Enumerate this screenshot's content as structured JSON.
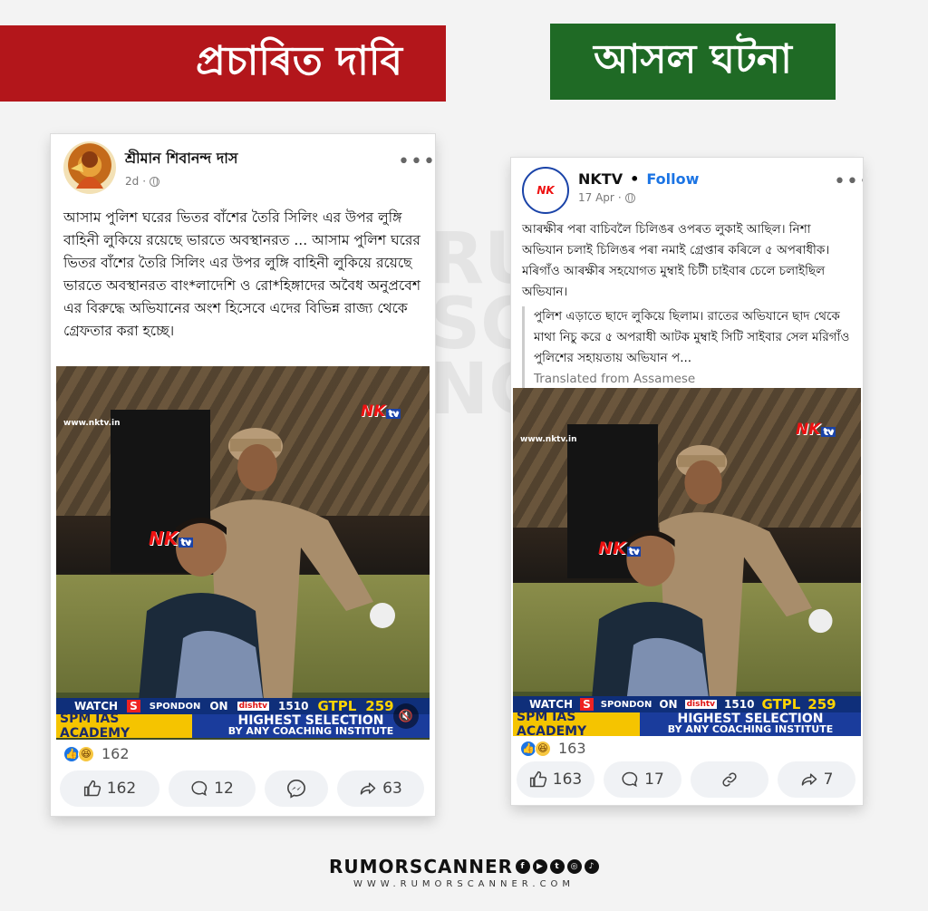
{
  "banners": {
    "claim_label": "প্ৰচাৰিত দাবি",
    "fact_label": "আসল ঘটনা"
  },
  "left_post": {
    "author": "শ্রীমান শিবানন্দ দাস",
    "time": "2d",
    "more_label": "•••",
    "text": "আসাম পুলিশ ঘরের ভিতর বাঁশের তৈরি সিলিং এর উপর লুঙ্গি বাহিনী লুকিয়ে রয়েছে ভারতে অবস্থানরত ... আসাম পুলিশ ঘরের ভিতর বাঁশের তৈরি সিলিং এর উপর লুঙ্গি বাহিনী লুকিয়ে রয়েছে ভারতে অবস্থানরত বাং*লাদেশি ও রো*হিঙ্গাদের অবৈধ অনুপ্রবেশ এর বিরুদ্ধে অভিযানের অংশ হিসেবে এদের বিভিন্ন রাজ্য থেকে গ্রেফতার করা হচ্ছে।",
    "reactions_count": "162",
    "actions": {
      "like": "162",
      "comment": "12",
      "share": "63"
    }
  },
  "right_post": {
    "author": "NKTV",
    "dot": "•",
    "follow_label": "Follow",
    "time": "17 Apr",
    "more_label": "•••",
    "avatar_text": "NK",
    "text": "আৰক্ষীৰ পৰা বাচিবলৈ চিলিঙৰ ওপৰত লুকাই আছিল। নিশা অভিযান চলাই চিলিঙৰ পৰা নমাই গ্ৰেপ্তাৰ কৰিলে ৫ অপৰাধীক। মৰিগাঁও আৰক্ষীৰ সহযোগত মুম্বাই চিটী চাইবাৰ চেলে চলাইছিল অভিযান।",
    "translation": "পুলিশ এড়াতে ছাদে লুকিয়ে ছিলাম। রাতের অভিযানে ছাদ থেকে মাথা নিচু করে ৫ অপরাধী আটক মুম্বাই সিটি সাইবার সেল মরিগাঁও পুলিশের সহায়তায় অভিযান প...",
    "translated_from": "Translated from Assamese",
    "reactions_count": "163",
    "actions": {
      "like": "163",
      "comment": "17",
      "share": "7"
    }
  },
  "video": {
    "site": "www.nktv.in",
    "logo": "NK",
    "logo_tv": "tv",
    "ticker_watch": "WATCH",
    "ticker_s": "S",
    "ticker_spondon": "SPONDON",
    "ticker_on": "ON",
    "ticker_dish": "dishtv",
    "ticker_num1": "1510",
    "ticker_gtpl": "GTPL",
    "ticker_num2": "259",
    "academy": "SPM IAS ACADEMY",
    "highest": "HIGHEST SELECTION",
    "coaching": "BY ANY COACHING INSTITUTE"
  },
  "watermark": "RU\nSCA\nNG",
  "footer": {
    "brand": "RUMORSCANNER",
    "url": "WWW.RUMORSCANNER.COM",
    "social_icons": [
      "facebook-icon",
      "youtube-icon",
      "twitter-icon",
      "instagram-icon",
      "tiktok-icon"
    ]
  },
  "colors": {
    "claim_red": "#b3161b",
    "fact_green": "#1f6a25",
    "fb_blue": "#1b74e4",
    "ticker_blue": "#0f2f7a",
    "ticker_yellow": "#f5c400"
  }
}
